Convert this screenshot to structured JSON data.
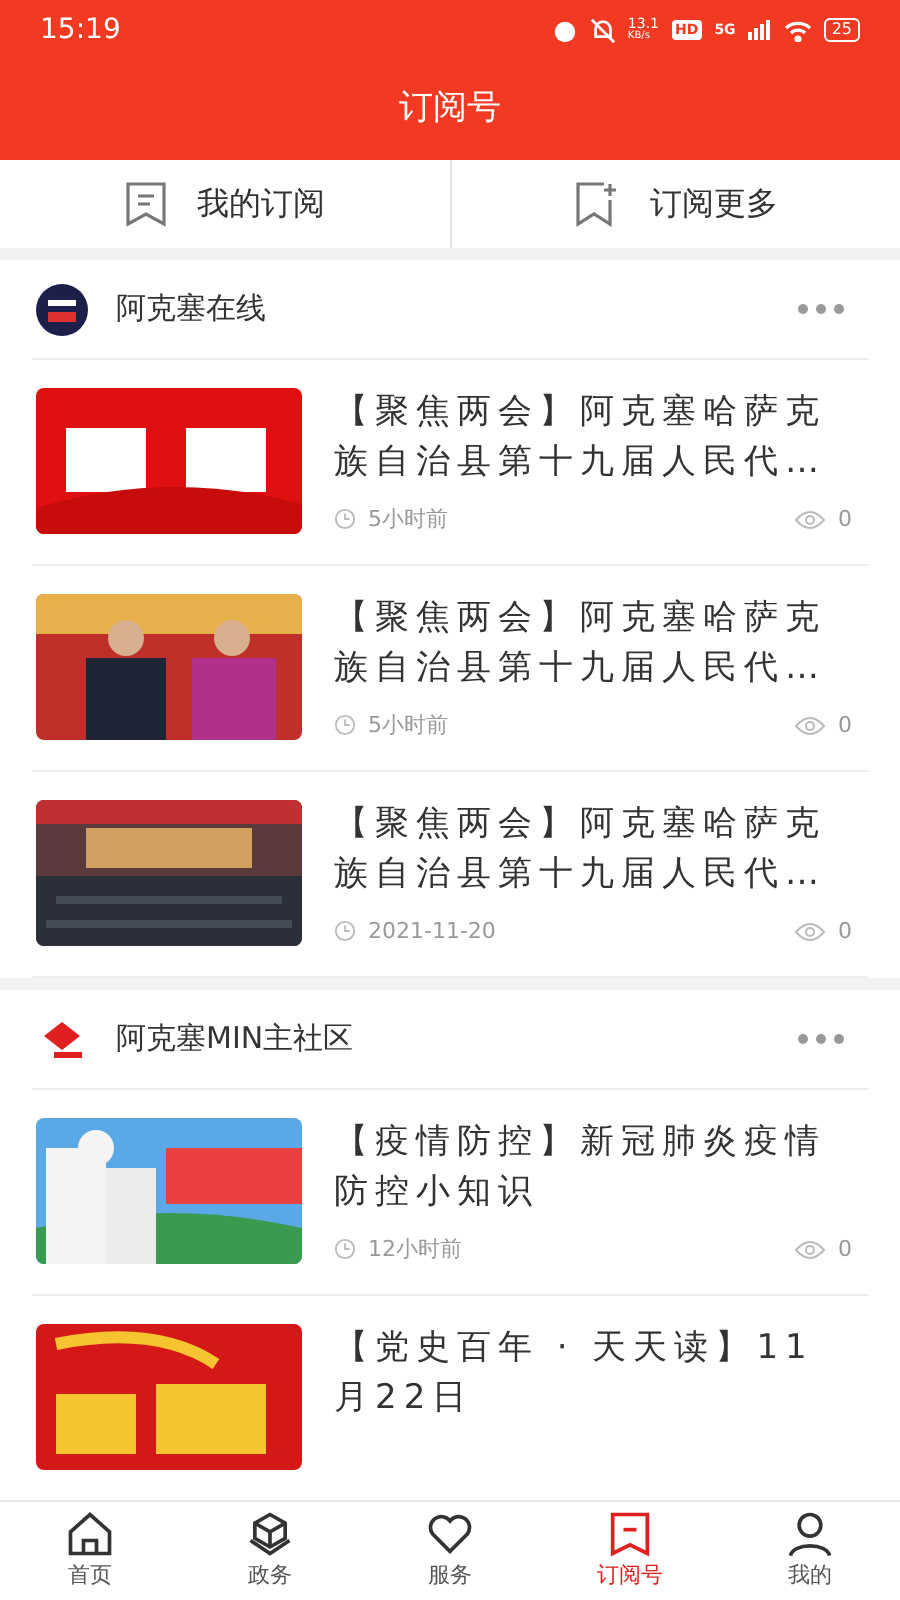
{
  "status_bar": {
    "time": "15:19",
    "speed": "13.1",
    "speed_unit": "KB/s",
    "hd": "HD",
    "network": "5G",
    "battery": "25"
  },
  "header": {
    "title": "订阅号"
  },
  "tabs": [
    {
      "label": "我的订阅",
      "kind": "mine"
    },
    {
      "label": "订阅更多",
      "kind": "more"
    }
  ],
  "sections": [
    {
      "name": "阿克塞在线",
      "articles": [
        {
          "title": "【聚焦两会】阿克塞哈萨克族自治县第十九届人民代…",
          "time": "5小时前",
          "views": "0"
        },
        {
          "title": "【聚焦两会】阿克塞哈萨克族自治县第十九届人民代…",
          "time": "5小时前",
          "views": "0"
        },
        {
          "title": "【聚焦两会】阿克塞哈萨克族自治县第十九届人民代…",
          "time": "2021-11-20",
          "views": "0"
        }
      ]
    },
    {
      "name": "阿克塞MIN主社区",
      "articles": [
        {
          "title": "【疫情防控】新冠肺炎疫情防控小知识",
          "time": "12小时前",
          "views": "0"
        },
        {
          "title": "【党史百年 · 天天读】11月22日"
        }
      ]
    }
  ],
  "nav": [
    {
      "label": "首页",
      "kind": "home",
      "selected": false
    },
    {
      "label": "政务",
      "kind": "cube",
      "selected": false
    },
    {
      "label": "服务",
      "kind": "heart",
      "selected": false
    },
    {
      "label": "订阅号",
      "kind": "bookmark",
      "selected": true
    },
    {
      "label": "我的",
      "kind": "user",
      "selected": false
    }
  ]
}
